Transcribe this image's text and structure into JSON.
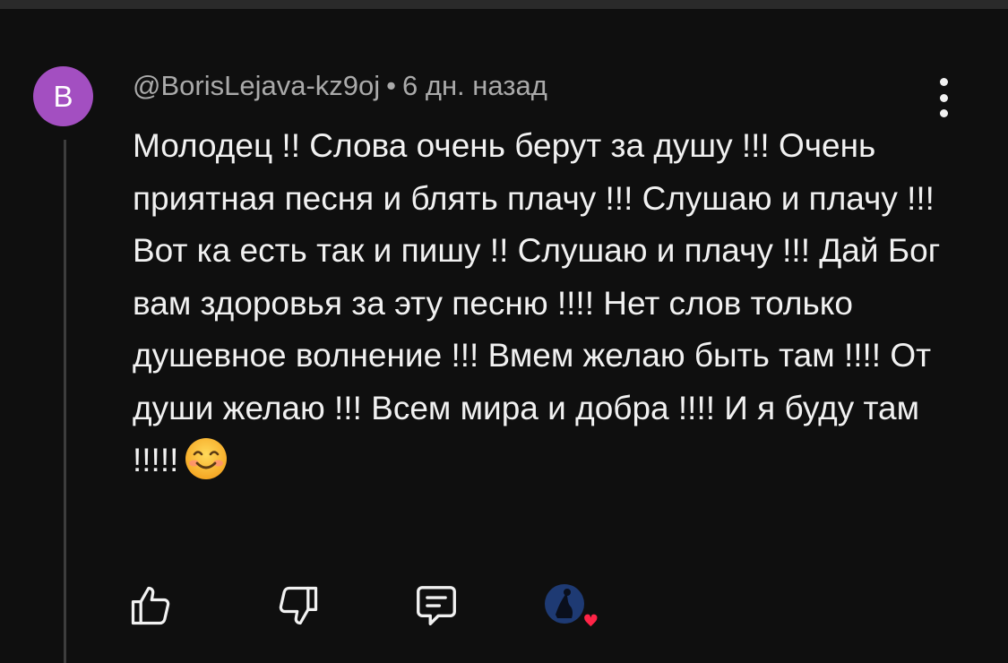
{
  "comment": {
    "avatar_letter": "B",
    "avatar_color": "#a34fc1",
    "author": "@BorisLejava-kz9oj",
    "separator": "•",
    "time": "6 дн. назад",
    "text": "Молодец !! Слова очень берут за душу !!! Очень приятная песня и блять плачу !!! Слушаю и плачу !!! Вот ка есть так и пишу !! Слушаю и плачу !!! Дай Бог вам здоровья за эту песню !!!! Нет слов только душевное волнение !!! Вмем желаю быть там !!!! От души желаю !!! Всем мира и добра !!!! И я буду там !!!!!",
    "emoji": "smiling-face-icon"
  },
  "actions": {
    "like_icon": "thumbs-up-icon",
    "dislike_icon": "thumbs-down-icon",
    "reply_icon": "comment-icon",
    "creator_heart_icon": "creator-heart-icon",
    "heart_color": "#ff2447"
  },
  "menu": {
    "icon": "more-vertical-icon"
  },
  "colors": {
    "background": "#0f0f0f",
    "text": "#f1f1f1",
    "meta": "#aaaaaa"
  }
}
